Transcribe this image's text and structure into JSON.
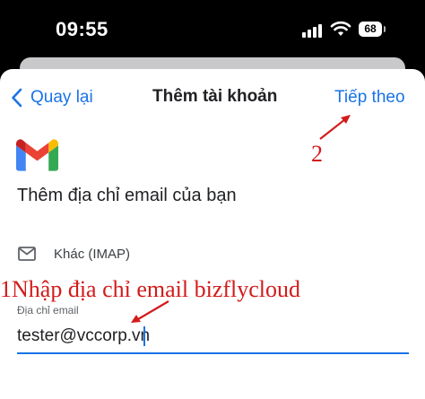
{
  "status_bar": {
    "time": "09:55",
    "battery": "68"
  },
  "nav": {
    "back_label": "Quay lại",
    "title": "Thêm tài khoản",
    "next_label": "Tiếp theo"
  },
  "content": {
    "heading": "Thêm địa chỉ email của bạn",
    "account_type": "Khác (IMAP)",
    "field_label": "Địa chỉ email",
    "field_value": "tester@vccorp.vn"
  },
  "annotations": {
    "step1": "1Nhập địa chỉ email bizflycloud",
    "step2": "2"
  },
  "colors": {
    "accent": "#1a73e8",
    "annotation": "#d31b1b"
  },
  "icons": [
    "signal-icon",
    "wifi-icon",
    "battery-icon",
    "chevron-left-icon",
    "gmail-logo",
    "mail-icon"
  ]
}
